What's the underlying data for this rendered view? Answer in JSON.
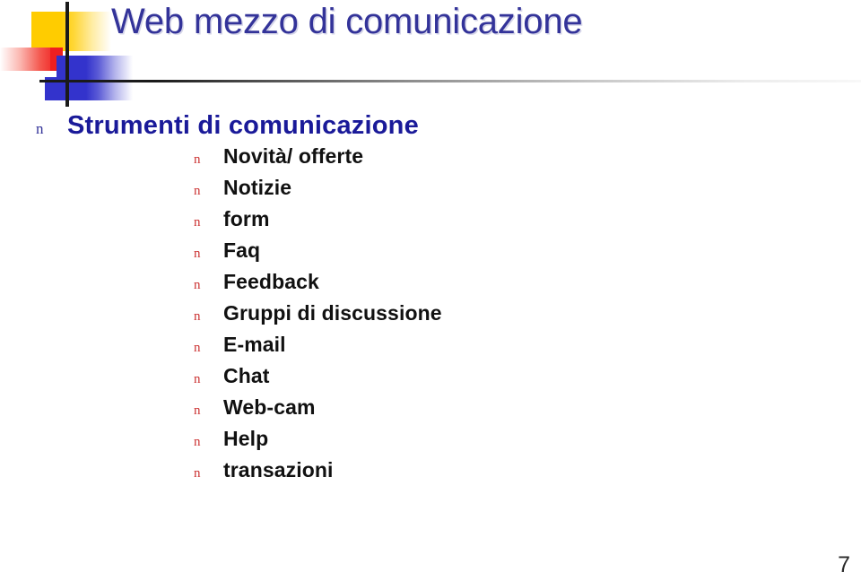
{
  "slide": {
    "title": "Web mezzo di comunicazione",
    "page_number": "7",
    "colors": {
      "title_blue": "#333399",
      "heading_blue": "#1a1a99",
      "bullet_red": "#cc3333",
      "logo_yellow": "#ffcc00",
      "logo_red": "#ef1f1f",
      "logo_blue": "#3333cc",
      "rule_black": "#1a1a1a",
      "body_text": "#111111"
    }
  },
  "content": {
    "level1": {
      "bullet_glyph": "n",
      "text": "Strumenti di comunicazione"
    },
    "level2_bullet_glyph": "n",
    "level2": [
      {
        "text": "Novità/ offerte"
      },
      {
        "text": "Notizie"
      },
      {
        "text": "form"
      },
      {
        "text": "Faq"
      },
      {
        "text": "Feedback"
      },
      {
        "text": "Gruppi di discussione"
      },
      {
        "text": "E-mail"
      },
      {
        "text": "Chat"
      },
      {
        "text": "Web-cam"
      },
      {
        "text": "Help"
      },
      {
        "text": "transazioni"
      }
    ]
  }
}
